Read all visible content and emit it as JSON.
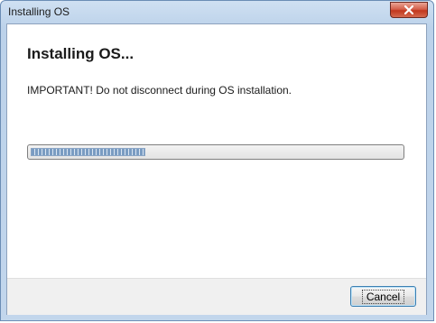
{
  "window": {
    "title": "Installing OS"
  },
  "dialog": {
    "heading": "Installing OS...",
    "message": "IMPORTANT! Do not disconnect during OS installation.",
    "progress_percent": 31
  },
  "buttons": {
    "close_icon": "close-x-icon",
    "cancel_label": "Cancel"
  },
  "colors": {
    "title_gradient_top": "#cfe0f2",
    "close_button": "#c2381e",
    "progress_fill": "#7a9cc2",
    "footer_bg": "#f0f0f0"
  }
}
